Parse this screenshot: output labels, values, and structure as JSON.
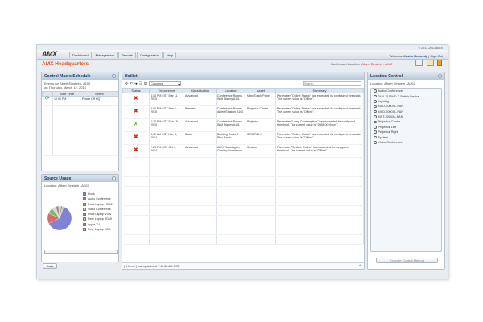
{
  "header": {
    "copyright": "© 2011-2013 AMX",
    "welcome_prefix": "Welcome",
    "user": "Justin Kennedy",
    "sign_out": "Sign Out",
    "logo": "AMX",
    "title": "AMX Headquarters",
    "dashboard_location_label": "Dashboard Location",
    "dashboard_location": "Albert Einstein - A102"
  },
  "nav": {
    "tabs": [
      "Dashboard",
      "Management",
      "Reports",
      "Configuration",
      "Help"
    ]
  },
  "macro": {
    "title": "Control Macro Schedule",
    "subtitle1": "Events for Albert Einstein - A102",
    "subtitle2": "on Thursday, March 12, 2015",
    "columns": [
      "Start Time",
      "Event"
    ],
    "rows": [
      {
        "time": "10:00 PM",
        "event": "Power Off HQ"
      }
    ]
  },
  "source": {
    "title": "Source Usage",
    "location": "Location: Albert Einstein - A102",
    "button": "Data",
    "legend": [
      {
        "label": "Kiosk",
        "color": "#7f83d6"
      },
      {
        "label": "Audio Conference",
        "color": "#d86a6a"
      },
      {
        "label": "Front Laptop HDMI",
        "color": "#7fb96a"
      },
      {
        "label": "Video Conference",
        "color": "#e7d4c9"
      },
      {
        "label": "Front Laptop VGA",
        "color": "#9a8aa0"
      },
      {
        "label": "Rear Laptop HDMI",
        "color": "#d9d08a"
      },
      {
        "label": "Apple TV",
        "color": "#c77a6a"
      },
      {
        "label": "Rear Laptop VGA",
        "color": "#8fd0c8"
      }
    ]
  },
  "hotlist": {
    "title": "Hotlist",
    "dropdown": "Columns",
    "search_placeholder": "Search",
    "columns": [
      "Status",
      "Occurrence",
      "Classification",
      "Location",
      "Asset",
      "Summary"
    ],
    "rows": [
      {
        "status": "offline",
        "occurrence": "4:30 PM CST Mar 11, 2015",
        "classification": "Advanced",
        "location": "Conference Rooms Walt Disney A111",
        "asset": "Main Touch Panel",
        "summary": "Parameter \"Online Status\" has exceeded its configured threshold. The current value is \"Offline\"."
      },
      {
        "status": "offline",
        "occurrence": "3:00 PM CST Mar 5, 2015",
        "classification": "Premier",
        "location": "Conference Rooms Albert Einstein A102",
        "asset": "Projector Center",
        "summary": "Parameter \"Online Status\" has exceeded its configured threshold. The current value is \"Offline\"."
      },
      {
        "status": "warning",
        "occurrence": "2:20 PM CST Feb 18, 2015",
        "classification": "Advanced",
        "location": "Conference Rooms Walt Disney A111",
        "asset": "Projector",
        "summary": "Parameter \"Lamp Consumption\" has exceeded its configured threshold. The current value is \"2058.00 Hours\"."
      },
      {
        "status": "offline",
        "occurrence": "8:42 AM CST Nov 4, 2014",
        "classification": "Basic",
        "location": "Building Radio 5 Plus Radio",
        "asset": "IDX5-RELY",
        "summary": "Parameter \"Online Status\" has exceeded its configured threshold. The current value is \"Offline\"."
      },
      {
        "status": "offline",
        "occurrence": "7:28 PM CST Oct 9, 2014",
        "classification": "Advanced",
        "location": "AMX Washington Charley Boardroom",
        "asset": "System",
        "summary": "Parameter \"System Online\" has exceeded its configured threshold. The current value is \"Offline\"."
      }
    ],
    "footer": "[ 5 items ]  Last updated at 7:46:58 AM CST"
  },
  "location_control": {
    "title": "Location Control",
    "location": "Location: Albert Einstein - A102",
    "items": [
      "Audio Conference",
      "DVX-3155HD-T Switch Device",
      "Lighting",
      "MXD-2000XL-PAN",
      "MXD-2000XL-PAN",
      "MXT-2000XL-PAN",
      "Projector Center",
      "Projector Left",
      "Projector Right",
      "System",
      "Video Conference"
    ],
    "button": "Execute Control Method"
  }
}
